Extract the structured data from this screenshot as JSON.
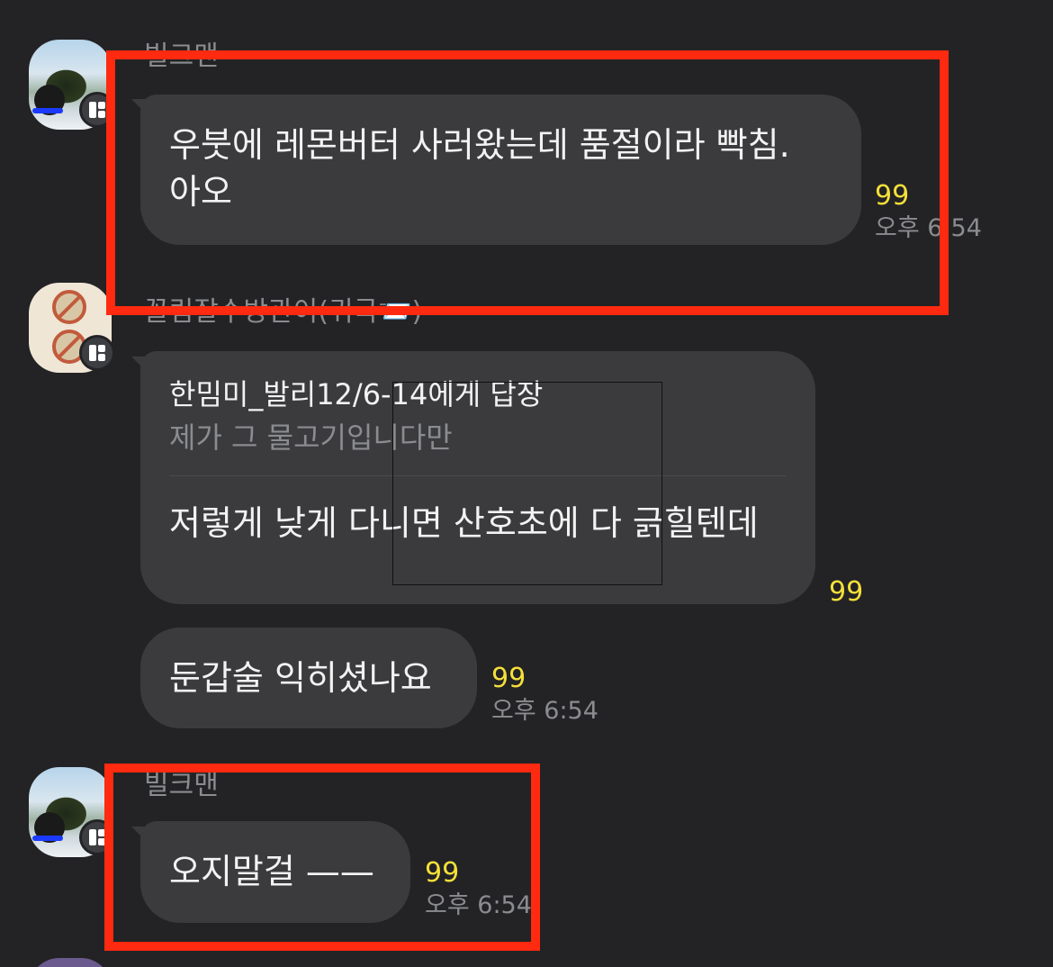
{
  "messages": [
    {
      "sender": "빌크맨",
      "text_line1": "우붓에 레몬버터 사러왔는데 품절이라 빡침.",
      "text_line2": "아오",
      "unread": "99",
      "time": "오후 6:54"
    },
    {
      "sender": "꼴림잘수방관이(귀국📨)",
      "reply_to": "한밈미_발리12/6-14에게 답장",
      "reply_quote": "제가 그 물고기입니다만",
      "text": "저렇게 낮게 다니면 산호초에 다 긁힐텐데",
      "unread": "99"
    },
    {
      "text": "둔갑술 익히셨나요",
      "unread": "99",
      "time": "오후 6:54"
    },
    {
      "sender": "빌크맨",
      "text": "오지말걸 ——",
      "unread": "99",
      "time": "오후 6:54"
    }
  ],
  "colors": {
    "background": "#232325",
    "bubble": "#3b3b3d",
    "unread": "#f4df3a",
    "highlight": "#ff2a0f"
  }
}
